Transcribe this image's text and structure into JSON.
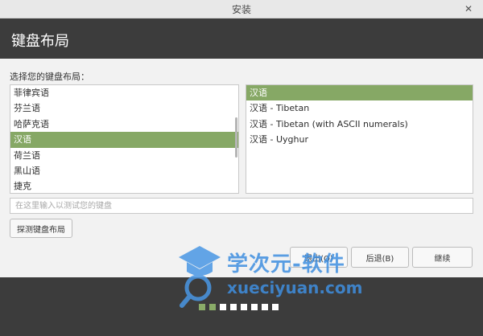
{
  "window": {
    "title": "安装"
  },
  "header": {
    "title": "键盘布局"
  },
  "main": {
    "prompt": "选择您的键盘布局：",
    "layouts": [
      "菲律宾语",
      "芬兰语",
      "哈萨克语",
      "汉语",
      "荷兰语",
      "黑山语",
      "捷克"
    ],
    "selected_layout": "汉语",
    "variants": [
      "汉语",
      "汉语 - Tibetan",
      "汉语 - Tibetan (with ASCII numerals)",
      "汉语 - Uyghur"
    ],
    "selected_variant": "汉语",
    "test_input": {
      "value": "",
      "placeholder": "在这里输入以测试您的键盘"
    },
    "detect_label": "探测键盘布局"
  },
  "buttons": {
    "quit": "退出(Q)",
    "back": "后退(B)",
    "next": "继续"
  },
  "progress": {
    "total": 8,
    "completed": 2
  },
  "watermark": {
    "line1": "学次元-软件",
    "line2": "xueciyuan.com"
  },
  "colors": {
    "accent": "#86a865",
    "header_bg": "#3c3c3c"
  }
}
